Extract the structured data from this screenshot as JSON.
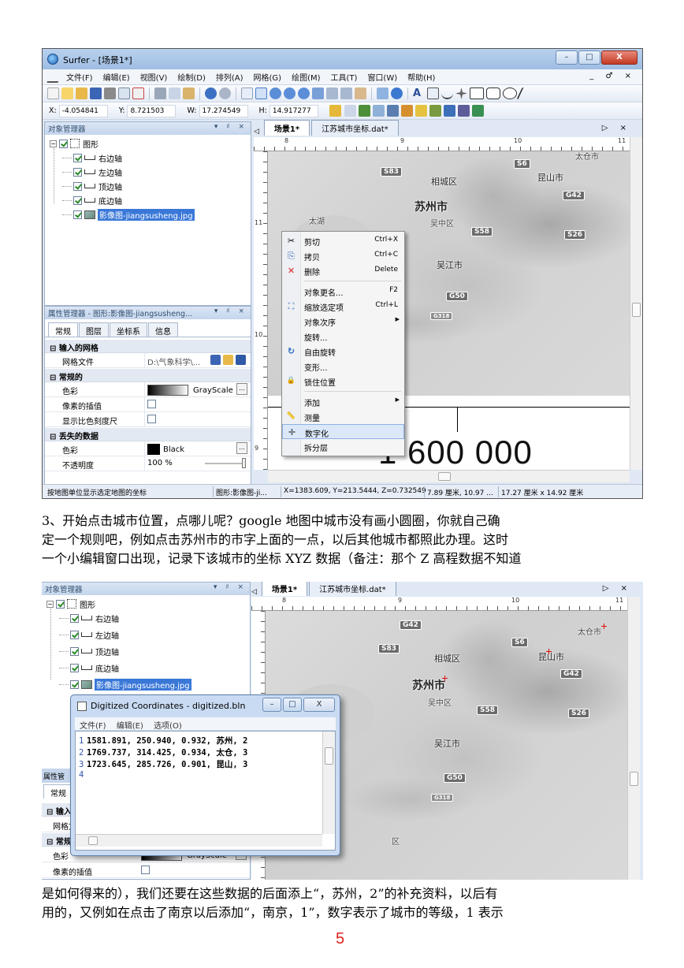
{
  "shot1": {
    "title": "Surfer - [场景1*]",
    "window_buttons": [
      "–",
      "□",
      "X"
    ],
    "menu": [
      "文件(F)",
      "编辑(E)",
      "视图(V)",
      "绘制(D)",
      "排列(A)",
      "网格(G)",
      "绘图(M)",
      "工具(T)",
      "窗口(W)",
      "帮助(H)"
    ],
    "menu_right": "_ ♂ ×",
    "coords": {
      "x_label": "X:",
      "x": "-4.054841",
      "y_label": "Y:",
      "y": "8.721503",
      "w_label": "W:",
      "w": "17.274549",
      "h_label": "H:",
      "h": "14.917277"
    },
    "object_manager": {
      "title": "对象管理器",
      "controls": "▾ ♯ ×",
      "root": "图形",
      "items": [
        "右边轴",
        "左边轴",
        "顶边轴",
        "底边轴"
      ],
      "image_item": "影像图-jiangsusheng.jpg"
    },
    "property_manager": {
      "title": "属性管理器 - 图形:影像图-jiangsusheng...",
      "controls": "▾ ♯ ×",
      "tabs": [
        "常规",
        "图层",
        "坐标系",
        "信息"
      ],
      "groups": {
        "input": "输入的网格",
        "general": "常规的",
        "missing": "丢失的数据"
      },
      "rows": {
        "grid_file_name": "网格文件",
        "grid_file_value": "D:\\气象科学\\...",
        "color_name": "色彩",
        "color_value": "GrayScale",
        "interp_name": "像素的插值",
        "scale_name": "显示比色刻度尺",
        "missing_color_name": "色彩",
        "missing_color_value": "Black",
        "opacity_name": "不透明度",
        "opacity_value": "100 %"
      }
    },
    "doc_tabs": [
      "场景1*",
      "江苏城市坐标.dat*"
    ],
    "doc_tab_right": "▷ ×",
    "ruler_h": [
      "8",
      "9",
      "10",
      "11"
    ],
    "ruler_v": [
      "11",
      "10",
      "9"
    ],
    "map_labels": {
      "s83": "S83",
      "s6": "S6",
      "g42": "G42",
      "s58": "S58",
      "s26": "S26",
      "g50": "G50",
      "g318": "G318",
      "xiangcheng": "相城区",
      "kunshan": "昆山市",
      "suzhou": "苏州市",
      "wuzhong": "吴中区",
      "wujiang": "吴江市",
      "taihu": "太湖",
      "taicang": "太仓市"
    },
    "context_menu": [
      {
        "label": "剪切",
        "shortcut": "Ctrl+X",
        "icon": "✂"
      },
      {
        "label": "拷贝",
        "shortcut": "Ctrl+C",
        "icon": "⎘"
      },
      {
        "label": "删除",
        "shortcut": "Delete",
        "icon": "✕"
      },
      {
        "label": "对象更名...",
        "shortcut": "F2",
        "icon": ""
      },
      {
        "label": "缩放选定项",
        "shortcut": "Ctrl+L",
        "icon": "⛶"
      },
      {
        "label": "对象次序",
        "shortcut": "",
        "icon": ""
      },
      {
        "label": "旋转...",
        "shortcut": "",
        "icon": ""
      },
      {
        "label": "自由旋转",
        "shortcut": "",
        "icon": "↻"
      },
      {
        "label": "变形...",
        "shortcut": "",
        "icon": ""
      },
      {
        "label": "锁住位置",
        "shortcut": "",
        "icon": "🔒"
      },
      {
        "label": "添加",
        "shortcut": "",
        "icon": ""
      },
      {
        "label": "测量",
        "shortcut": "",
        "icon": "📏"
      },
      {
        "label": "数字化",
        "shortcut": "",
        "icon": "✛"
      },
      {
        "label": "拆分层",
        "shortcut": "",
        "icon": ""
      }
    ],
    "big_number": "1 600 000",
    "status": {
      "hint": "按地图单位显示选定地图的坐标",
      "object": "图形:影像图-ji...",
      "xyz": "X=1383.609, Y=213.5444, Z=0.732549",
      "pos": "7.89 厘米, 10.97 ...",
      "size": "17.27 厘米 x 14.92 厘米"
    }
  },
  "paragraph1": [
    "    3、开始点击城市位置，点哪儿呢？google 地图中城市没有画小圆圈，你就自己确",
    "定一个规则吧，例如点击苏州市的市字上面的一点，以后其他城市都照此办理。这时",
    "一个小编辑窗口出现，记录下该城市的坐标 XYZ 数据（备注：那个 Z 高程数据不知道"
  ],
  "shot2": {
    "dialog": {
      "title": "Digitized Coordinates - digitized.bln",
      "buttons": [
        "–",
        "□",
        "X"
      ],
      "menu": [
        "文件(F)",
        "编辑(E)",
        "选项(O)"
      ],
      "lines": [
        {
          "n": "1",
          "text": "1581.891, 250.940, 0.932, 苏州, 2"
        },
        {
          "n": "2",
          "text": "1769.737, 314.425, 0.934, 太仓, 3"
        },
        {
          "n": "3",
          "text": "1723.645, 285.726, 0.901, 昆山, 3"
        },
        {
          "n": "4",
          "text": ""
        }
      ]
    },
    "partial_tab": "常规",
    "partial_labels": [
      "属性管",
      "输入",
      "网格文件",
      "区"
    ]
  },
  "paragraph2": [
    "是如何得来的），我们还要在这些数据的后面添上“，苏州，2”的补充资料，以后有",
    "用的，又例如在点击了南京以后添加“，南京，1”，数字表示了城市的等级，1 表示"
  ],
  "page_number": "5"
}
